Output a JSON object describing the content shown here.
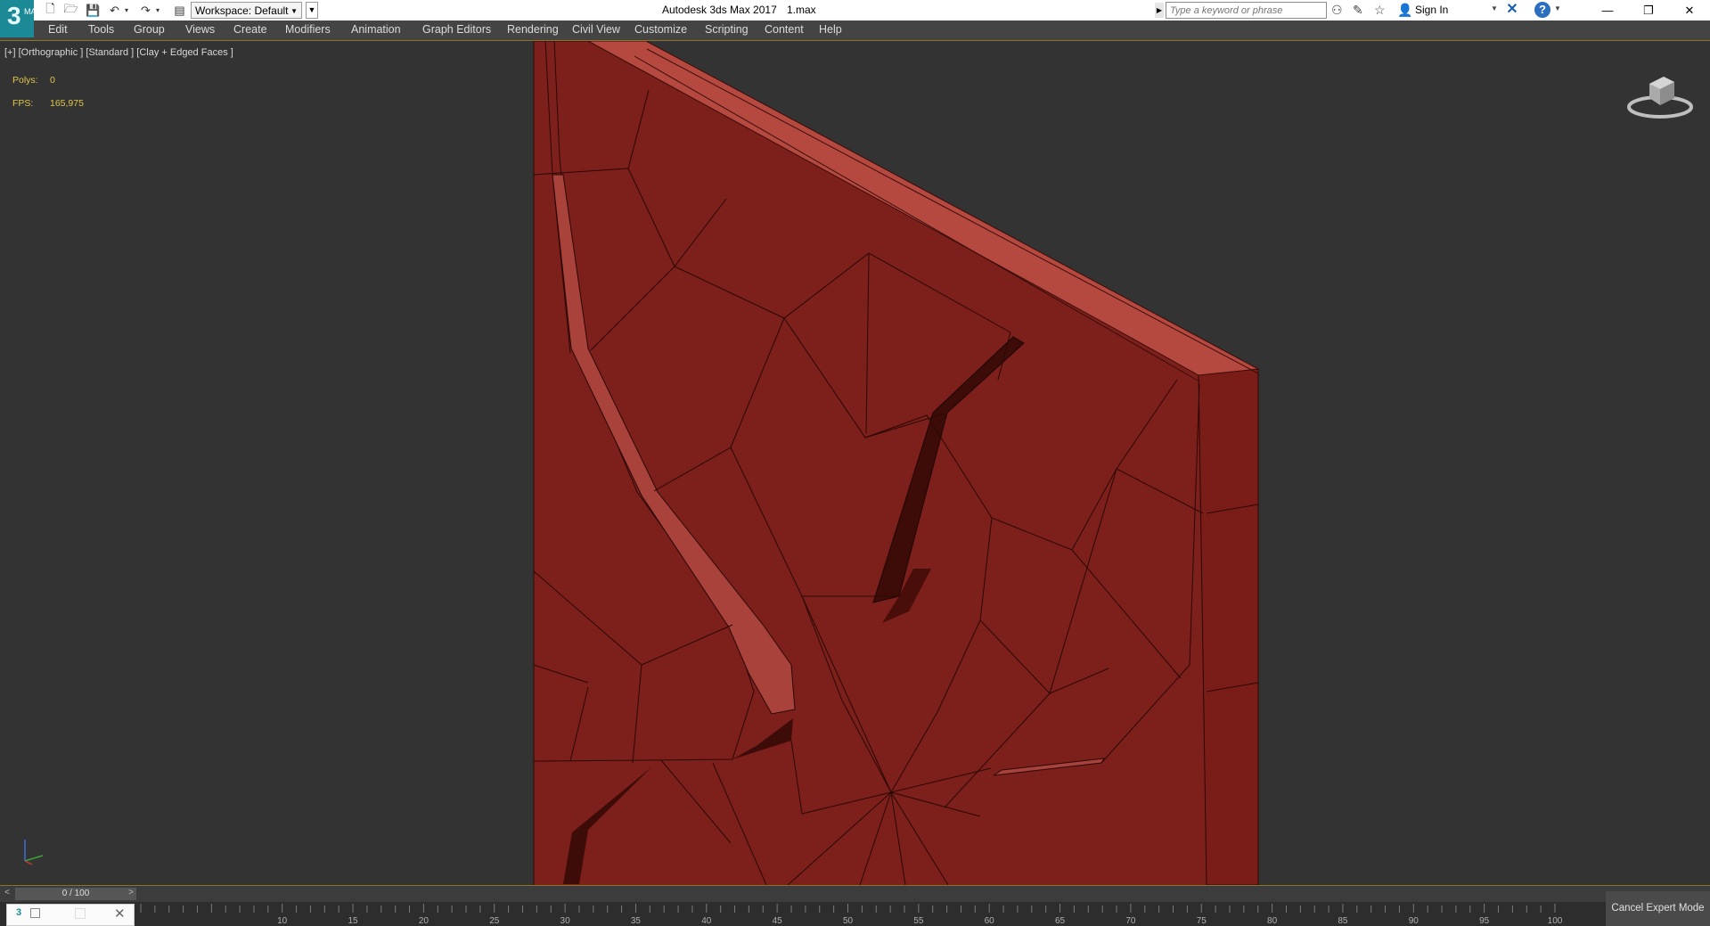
{
  "titlebar": {
    "logo_text": "3",
    "logo_sub": "MAX",
    "workspace_label": "Workspace: Default",
    "app_title": "Autodesk 3ds Max 2017",
    "file_name": "1.max",
    "search_placeholder": "Type a keyword or phrase",
    "signin_label": "Sign In"
  },
  "menubar": {
    "items": [
      "Edit",
      "Tools",
      "Group",
      "Views",
      "Create",
      "Modifiers",
      "Animation",
      "Graph Editors",
      "Rendering",
      "Civil View",
      "Customize",
      "Scripting",
      "Content",
      "Help"
    ]
  },
  "viewport": {
    "label": "[+] [Orthographic ] [Standard ] [Clay + Edged Faces ]",
    "stats": {
      "polys_label": "Polys:",
      "polys_value": "0",
      "fps_label": "FPS:",
      "fps_value": "165,975"
    },
    "model_color": "#7d1f1a",
    "model_top_color": "#b5483f"
  },
  "timeslider": {
    "frame_display": "0 / 100",
    "left_arrow": "<",
    "right_arrow": ">"
  },
  "trackbar": {
    "tick_labels": [
      "10",
      "15",
      "20",
      "25",
      "30",
      "35",
      "40",
      "45",
      "50",
      "55",
      "60",
      "65",
      "70",
      "75",
      "80",
      "85",
      "90",
      "95",
      "100"
    ]
  },
  "statusbar": {
    "cancel_expert_label": "Cancel Expert Mode"
  }
}
